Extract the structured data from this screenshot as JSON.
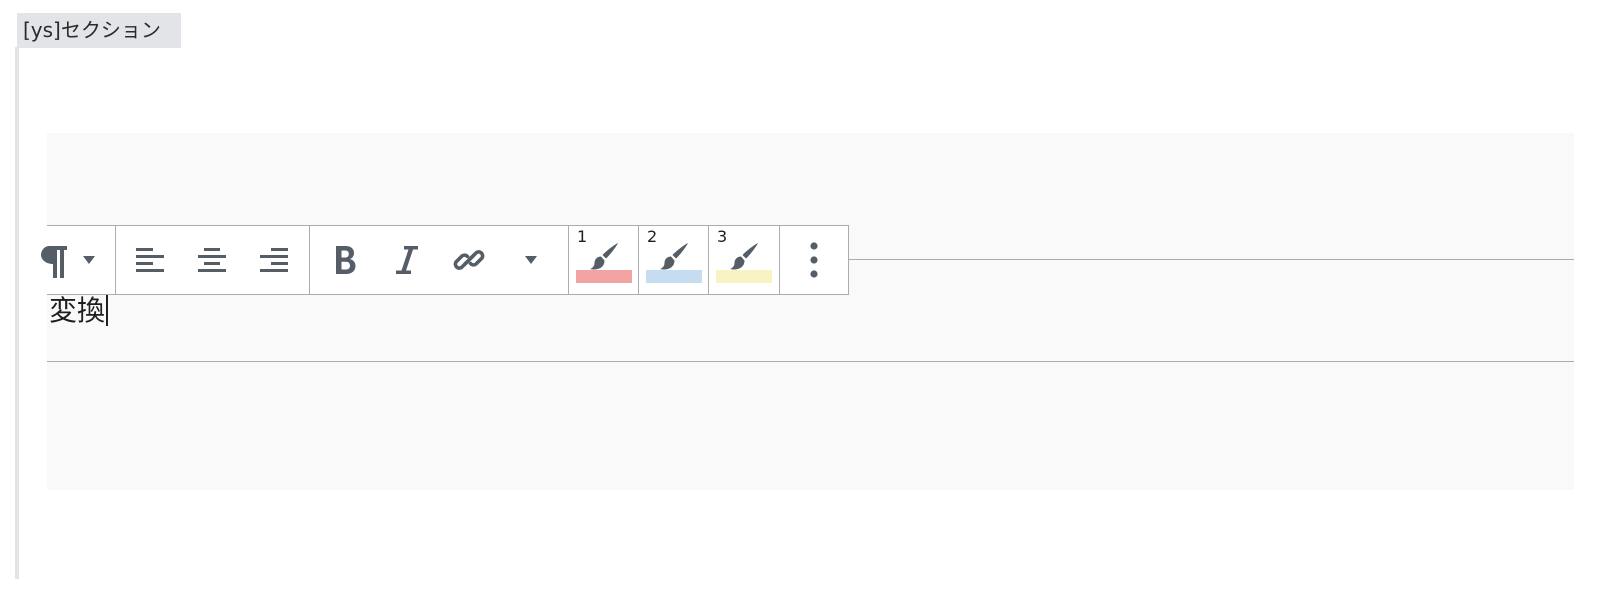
{
  "section": {
    "label": "[ys]セクション"
  },
  "paragraph": {
    "text": "変換"
  },
  "toolbar": {
    "block_type_icon": "pilcrow-icon",
    "align_items": [
      {
        "icon": "align-left-icon"
      },
      {
        "icon": "align-center-icon"
      },
      {
        "icon": "align-right-icon"
      }
    ],
    "format_items": [
      {
        "icon": "bold-icon"
      },
      {
        "icon": "italic-icon"
      },
      {
        "icon": "link-icon"
      },
      {
        "icon": "chevron-down-icon"
      }
    ],
    "highlighters": [
      {
        "number": "1",
        "color": "#f2a3a3"
      },
      {
        "number": "2",
        "color": "#c6dcf0"
      },
      {
        "number": "3",
        "color": "#f8f3c3"
      }
    ],
    "more_icon": "more-vertical-icon"
  },
  "colors": {
    "icon": "#555d66",
    "border": "#a9adb1",
    "canvas": "#f9f9f9",
    "section_tag": "#e2e4e7"
  }
}
